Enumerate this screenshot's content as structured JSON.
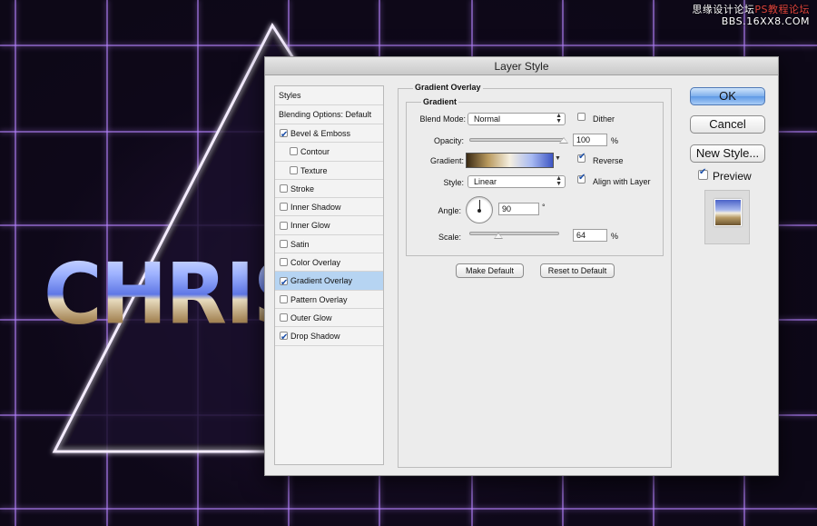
{
  "background": {
    "watermark_line1": "思缘设计论坛",
    "watermark_line1_accent": "PS教程论坛",
    "watermark_line2": "BBS.16XX8.COM",
    "artwork_text": "CHRIS"
  },
  "dialog": {
    "title": "Layer Style",
    "styles_list": {
      "header": "Styles",
      "blending_options": "Blending Options: Default",
      "items": [
        {
          "label": "Bevel & Emboss",
          "checked": true,
          "sub": false,
          "selected": false
        },
        {
          "label": "Contour",
          "checked": false,
          "sub": true,
          "selected": false
        },
        {
          "label": "Texture",
          "checked": false,
          "sub": true,
          "selected": false
        },
        {
          "label": "Stroke",
          "checked": false,
          "sub": false,
          "selected": false
        },
        {
          "label": "Inner Shadow",
          "checked": false,
          "sub": false,
          "selected": false
        },
        {
          "label": "Inner Glow",
          "checked": false,
          "sub": false,
          "selected": false
        },
        {
          "label": "Satin",
          "checked": false,
          "sub": false,
          "selected": false
        },
        {
          "label": "Color Overlay",
          "checked": false,
          "sub": false,
          "selected": false
        },
        {
          "label": "Gradient Overlay",
          "checked": true,
          "sub": false,
          "selected": true
        },
        {
          "label": "Pattern Overlay",
          "checked": false,
          "sub": false,
          "selected": false
        },
        {
          "label": "Outer Glow",
          "checked": false,
          "sub": false,
          "selected": false
        },
        {
          "label": "Drop Shadow",
          "checked": true,
          "sub": false,
          "selected": false
        }
      ]
    },
    "gradient_overlay": {
      "section_title": "Gradient Overlay",
      "group_title": "Gradient",
      "blend_mode_label": "Blend Mode:",
      "blend_mode_value": "Normal",
      "dither_label": "Dither",
      "dither_checked": false,
      "opacity_label": "Opacity:",
      "opacity_value": "100",
      "opacity_fraction": 1.0,
      "opacity_unit": "%",
      "gradient_label": "Gradient:",
      "gradient_colors": [
        "#3a2a14",
        "#b99a5f",
        "#f5efe0",
        "#a9bbf2",
        "#3e56c4"
      ],
      "reverse_label": "Reverse",
      "reverse_checked": true,
      "style_label": "Style:",
      "style_value": "Linear",
      "align_label": "Align with Layer",
      "align_checked": true,
      "angle_label": "Angle:",
      "angle_value": "90",
      "angle_unit": "°",
      "scale_label": "Scale:",
      "scale_value": "64",
      "scale_fraction": 0.32,
      "scale_unit": "%",
      "make_default_label": "Make Default",
      "reset_default_label": "Reset to Default"
    },
    "buttons": {
      "ok_label": "OK",
      "cancel_label": "Cancel",
      "new_style_label": "New Style...",
      "preview_label": "Preview",
      "preview_checked": true
    }
  }
}
